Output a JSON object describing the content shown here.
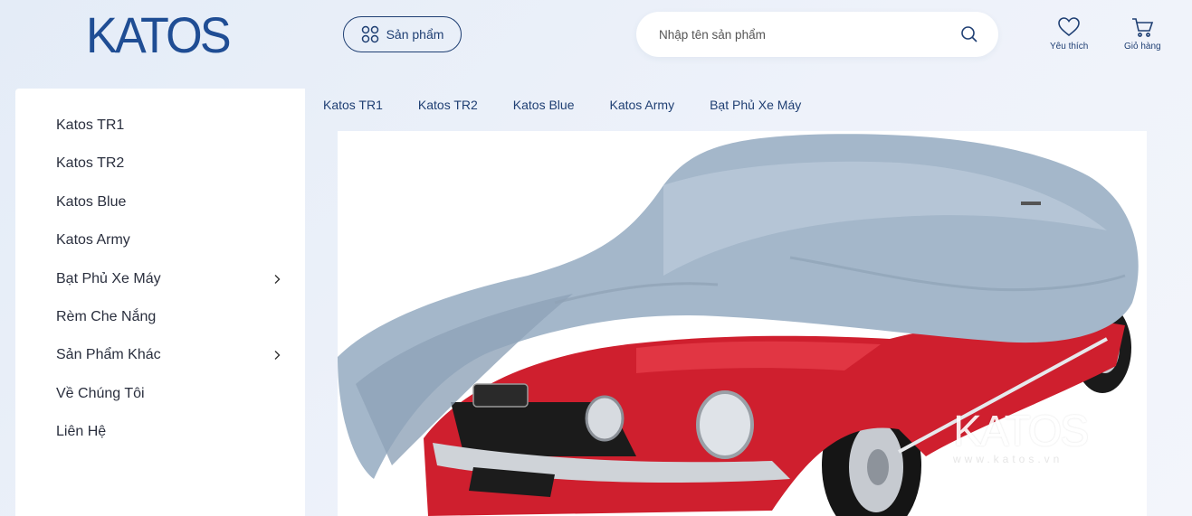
{
  "header": {
    "logo": "KATOS",
    "products_button": "Sản phẩm",
    "search_placeholder": "Nhập tên sản phẩm",
    "favorites_label": "Yêu thích",
    "cart_label": "Giỏ hàng"
  },
  "sidebar": {
    "items": [
      {
        "label": "Katos TR1",
        "has_submenu": false
      },
      {
        "label": "Katos TR2",
        "has_submenu": false
      },
      {
        "label": "Katos Blue",
        "has_submenu": false
      },
      {
        "label": "Katos Army",
        "has_submenu": false
      },
      {
        "label": "Bạt Phủ Xe Máy",
        "has_submenu": true
      },
      {
        "label": "Rèm Che Nắng",
        "has_submenu": false
      },
      {
        "label": "Sản Phẩm Khác",
        "has_submenu": true
      },
      {
        "label": "Về Chúng Tôi",
        "has_submenu": false
      },
      {
        "label": "Liên Hệ",
        "has_submenu": false
      }
    ]
  },
  "topnav": {
    "items": [
      "Katos TR1",
      "Katos TR2",
      "Katos Blue",
      "Katos Army",
      "Bạt Phủ Xe Máy"
    ]
  },
  "hero": {
    "watermark": "KATOS",
    "watermark_url": "www.katos.vn"
  },
  "colors": {
    "brand": "#1f4d94",
    "nav_text": "#1f3f73",
    "car_red": "#d8202f",
    "cover_blue": "#9fb3c7"
  }
}
